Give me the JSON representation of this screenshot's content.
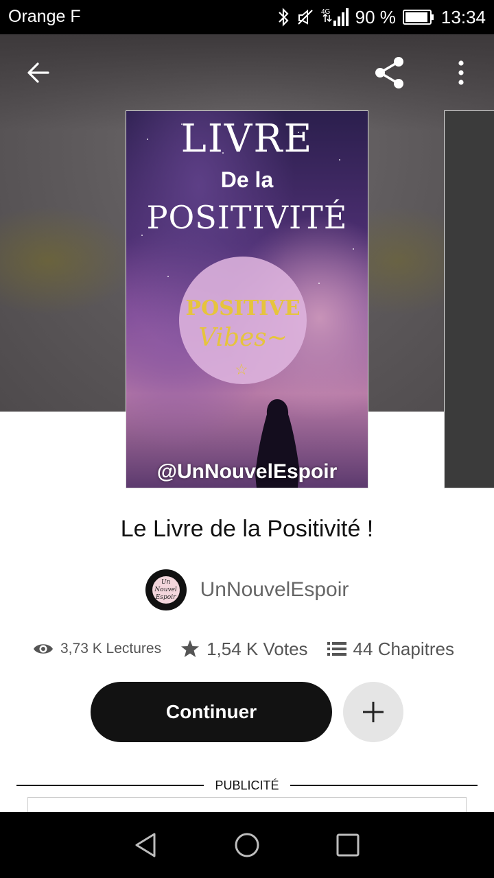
{
  "status_bar": {
    "carrier": "Orange F",
    "network": "4G",
    "battery": "90 %",
    "time": "13:34",
    "icons": [
      "bluetooth-icon",
      "mute-icon",
      "signal-icon",
      "battery-icon"
    ]
  },
  "toolbar": {
    "back_icon": "arrow-left-icon",
    "share_icon": "share-icon",
    "more_icon": "more-vertical-icon"
  },
  "cover": {
    "line1": "LIVRE",
    "line2": "De la",
    "line3": "POSITIVITÉ",
    "badge_line1": "POSITIVE",
    "badge_line2": "Vibes~",
    "badge_star": "☆",
    "handle": "@UnNouvelEspoir"
  },
  "story": {
    "title": "Le Livre de la Positivité !",
    "author": "UnNouvelEspoir",
    "avatar_text": "Un Nouvel Espoir"
  },
  "stats": {
    "reads": "3,73 K Lectures",
    "votes": "1,54 K Votes",
    "chapters": "44 Chapitres"
  },
  "actions": {
    "continue_label": "Continuer",
    "add_icon": "plus-icon"
  },
  "ad": {
    "label": "PUBLICITÉ"
  },
  "nav_bar": {
    "back_icon": "triangle-back-icon",
    "home_icon": "circle-home-icon",
    "recents_icon": "square-recents-icon"
  },
  "colors": {
    "primary_button": "#121212",
    "secondary_button": "#e5e5e5",
    "badge_text": "#e6c43c"
  }
}
